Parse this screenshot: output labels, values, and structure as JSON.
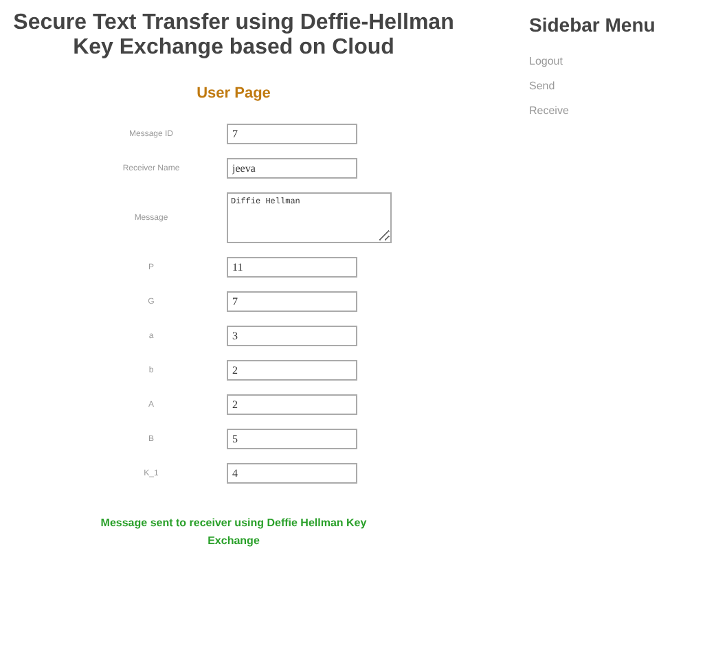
{
  "header": {
    "title": "Secure Text Transfer using Deffie-Hellman Key Exchange based on Cloud"
  },
  "page_heading": "User Page",
  "form_fields": [
    {
      "kind": "input",
      "label": "Message ID",
      "value": "7"
    },
    {
      "kind": "input",
      "label": "Receiver Name",
      "value": "jeeva"
    },
    {
      "kind": "textarea",
      "label": "Message",
      "value": "Diffie Hellman"
    },
    {
      "kind": "input",
      "label": "P",
      "value": "11"
    },
    {
      "kind": "input",
      "label": "G",
      "value": "7"
    },
    {
      "kind": "input",
      "label": "a",
      "value": "3"
    },
    {
      "kind": "input",
      "label": "b",
      "value": "2"
    },
    {
      "kind": "input",
      "label": "A",
      "value": "2"
    },
    {
      "kind": "input",
      "label": "B",
      "value": "5"
    },
    {
      "kind": "input",
      "label": "K_1",
      "value": "4"
    }
  ],
  "status_message": "Message sent to receiver using Deffie Hellman Key Exchange",
  "sidebar": {
    "title": "Sidebar Menu",
    "items": [
      "Logout",
      "Send",
      "Receive"
    ]
  }
}
